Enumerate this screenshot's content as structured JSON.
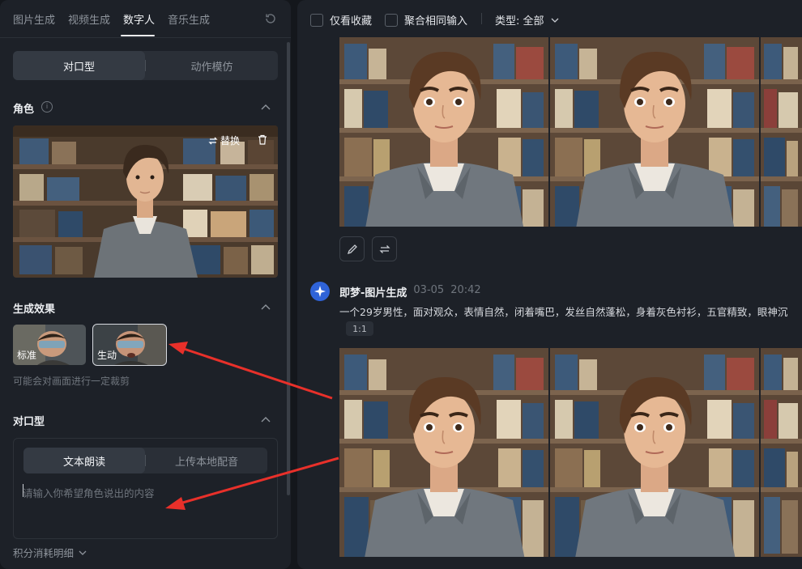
{
  "left_panel": {
    "tabs": [
      "图片生成",
      "视频生成",
      "数字人",
      "音乐生成"
    ],
    "active_tab": 2,
    "mode_segment": {
      "items": [
        "对口型",
        "动作模仿"
      ],
      "active": 0
    },
    "role_section": {
      "title": "角色",
      "replace_label": "替换"
    },
    "effect_section": {
      "title": "生成效果",
      "options": [
        "标准",
        "生动"
      ],
      "selected": 1,
      "hint": "可能会对画面进行一定裁剪"
    },
    "lip_section": {
      "title": "对口型",
      "segment": {
        "items": [
          "文本朗读",
          "上传本地配音"
        ],
        "active": 0
      },
      "placeholder": "请输入你希望角色说出的内容"
    },
    "cost_label": "积分消耗明细"
  },
  "right_panel": {
    "filters": {
      "favorites_label": "仅看收藏",
      "merge_label": "聚合相同输入",
      "type_label": "类型: 全部"
    },
    "message": {
      "sender": "即梦-图片生成",
      "date": "03-05",
      "time": "20:42",
      "prompt": "一个29岁男性，面对观众，表情自然，闭着嘴巴，发丝自然蓬松，身着灰色衬衫，五官精致，眼神沉",
      "ratio": "1:1"
    }
  },
  "colors": {
    "accent": "#2f63d8",
    "panel_bg": "#1d2128",
    "page_bg": "#14171c",
    "arrow": "#e8302a"
  }
}
